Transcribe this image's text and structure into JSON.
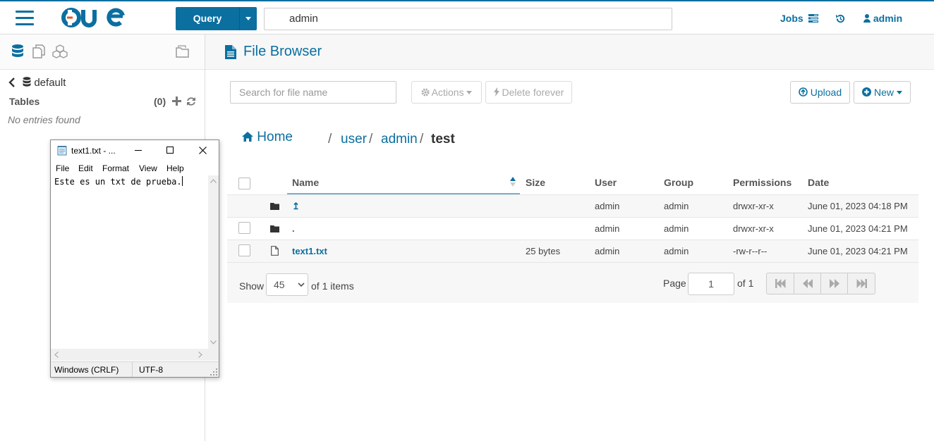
{
  "topbar": {
    "query_label": "Query",
    "search_value": "admin",
    "jobs_label": "Jobs",
    "user_label": "admin"
  },
  "sidebar": {
    "database": "default",
    "tables_label": "Tables",
    "tables_count": "(0)",
    "empty_text": "No entries found"
  },
  "main": {
    "title": "File Browser",
    "search_placeholder": "Search for file name",
    "actions_label": "Actions",
    "delete_label": "Delete forever",
    "upload_label": "Upload",
    "new_label": "New",
    "breadcrumb": {
      "home": "Home",
      "parts": [
        "user",
        "admin",
        "test"
      ]
    },
    "table": {
      "columns": [
        "Name",
        "Size",
        "User",
        "Group",
        "Permissions",
        "Date"
      ],
      "rows": [
        {
          "name": "↥",
          "size": "",
          "user": "admin",
          "group": "admin",
          "permissions": "drwxr-xr-x",
          "date": "June 01, 2023 04:18 PM"
        },
        {
          "name": ".",
          "size": "",
          "user": "admin",
          "group": "admin",
          "permissions": "drwxr-xr-x",
          "date": "June 01, 2023 04:21 PM"
        },
        {
          "name": "text1.txt",
          "size": "25 bytes",
          "user": "admin",
          "group": "admin",
          "permissions": "-rw-r--r--",
          "date": "June 01, 2023 04:21 PM"
        }
      ]
    },
    "pager": {
      "show_label": "Show",
      "page_size": "45",
      "items_label": "of 1 items",
      "page_label": "Page",
      "page_value": "1",
      "of_pages": "of 1"
    }
  },
  "notepad": {
    "title": "text1.txt - ...",
    "menu": [
      "File",
      "Edit",
      "Format",
      "View",
      "Help"
    ],
    "content": "Este es un txt de prueba.",
    "status_eol": "Windows (CRLF)",
    "status_encoding": "UTF-8"
  },
  "colors": {
    "accent": "#0b6fa0"
  }
}
